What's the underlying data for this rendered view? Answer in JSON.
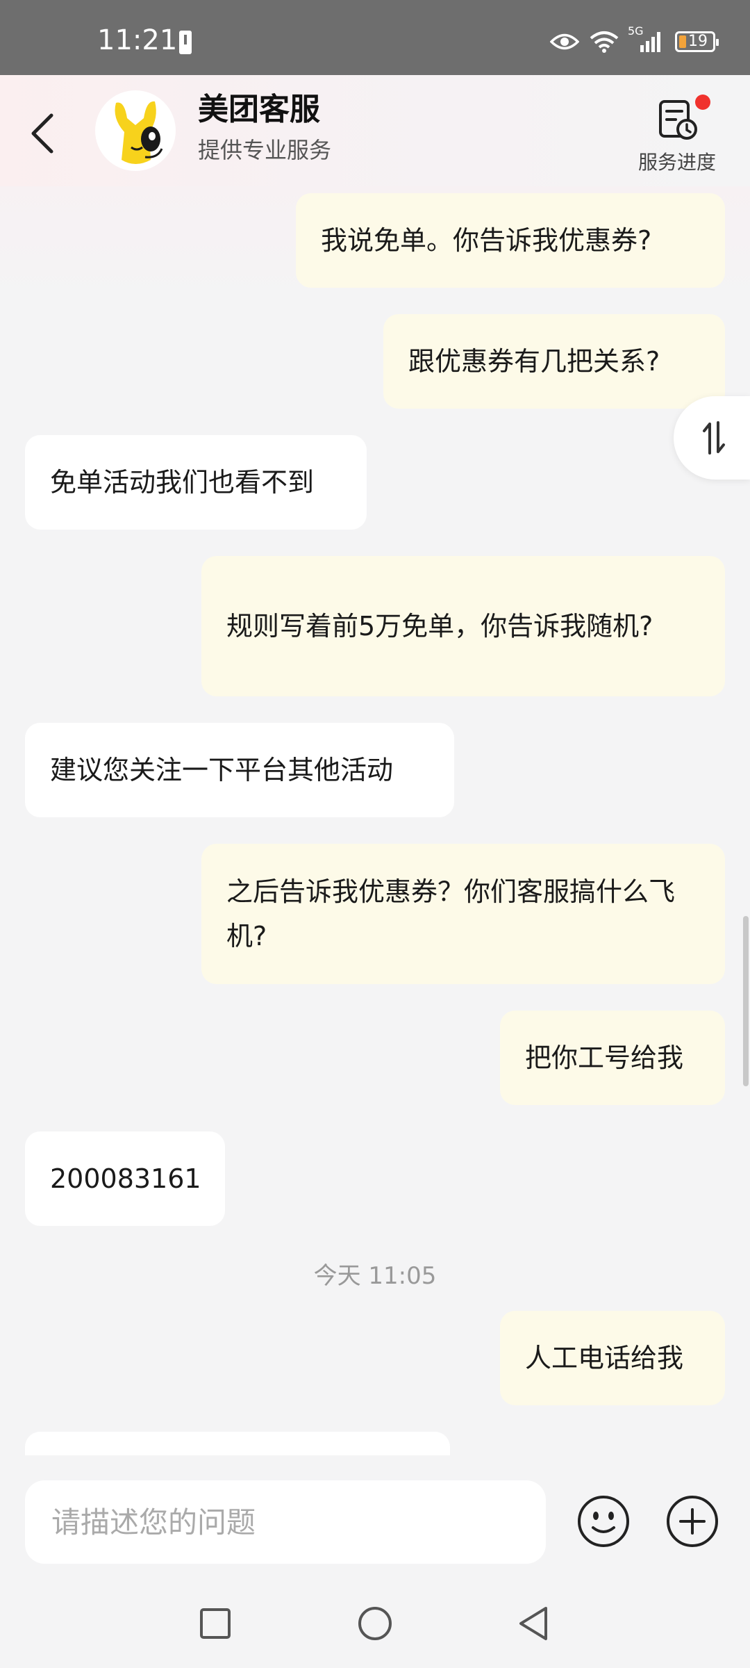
{
  "status_bar": {
    "time": "11:21",
    "battery": "19",
    "network": "5G"
  },
  "header": {
    "title": "美团客服",
    "subtitle": "提供专业服务",
    "progress_label": "服务进度"
  },
  "messages": [
    {
      "from": "me",
      "text": "我说免单。你告诉我优惠券?"
    },
    {
      "from": "me",
      "text": "跟优惠券有几把关系?"
    },
    {
      "from": "them",
      "text": "免单活动我们也看不到"
    },
    {
      "from": "me",
      "text": "规则写着前5万免单，你告诉我随机?"
    },
    {
      "from": "them",
      "text": "建议您关注一下平台其他活动"
    },
    {
      "from": "me",
      "text": "之后告诉我优惠券？你们客服搞什么飞机?"
    },
    {
      "from": "me",
      "text": "把你工号给我"
    },
    {
      "from": "them",
      "text": "200083161"
    },
    {
      "from": "me",
      "text": "人工电话给我"
    }
  ],
  "timestamp": "今天 11:05",
  "input": {
    "placeholder": "请描述您的问题"
  },
  "colors": {
    "my_bubble": "#fdfae8",
    "their_bubble": "#ffffff",
    "badge": "#f0322d",
    "avatar_yellow": "#f7d21c"
  },
  "icons": {
    "back": "chevron-left-icon",
    "progress": "document-clock-icon",
    "float": "swap-vertical-icon",
    "emoji": "smiley-icon",
    "plus": "plus-circle-icon"
  }
}
